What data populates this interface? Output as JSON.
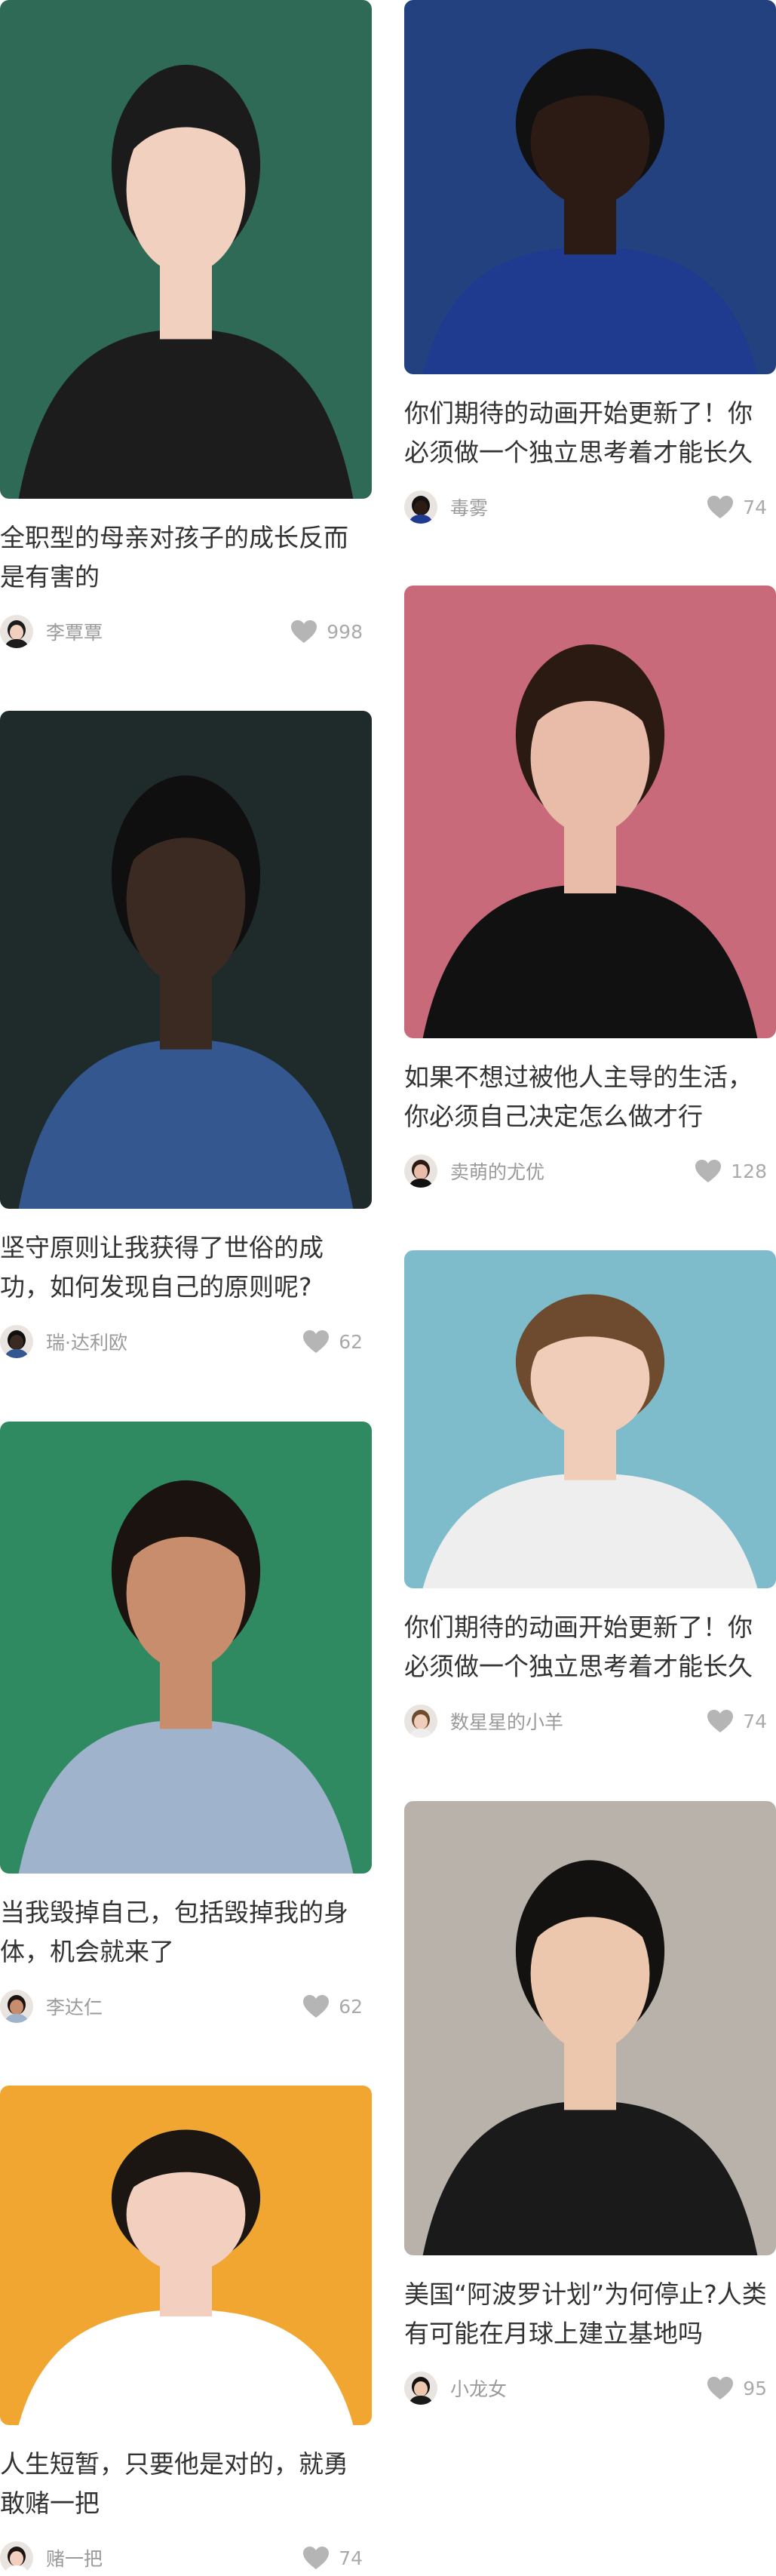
{
  "cards": [
    {
      "id": "c1",
      "title": "全职型的母亲对孩子的成长反而是有害的",
      "author": "李覃覃",
      "likes": "998",
      "bg": "#2e6a55",
      "skin": "#f1d0bf",
      "hair": "#1b1b1b",
      "shirt": "#1c1c1c"
    },
    {
      "id": "c2",
      "title": "你们期待的动画开始更新了！你必须做一个独立思考着才能长久",
      "author": "毒雾",
      "likes": "74",
      "bg": "#23407f",
      "skin": "#2b1b14",
      "hair": "#111111",
      "shirt": "#1f3b8f"
    },
    {
      "id": "c3",
      "title": "坚守原则让我获得了世俗的成功，如何发现自己的原则呢?",
      "author": "瑞·达利欧",
      "likes": "62",
      "bg": "#1f2a2a",
      "skin": "#3b2a22",
      "hair": "#0f0f0f",
      "shirt": "#33578e"
    },
    {
      "id": "c4",
      "title": "如果不想过被他人主导的生活，你必须自己决定怎么做才行",
      "author": "卖萌的尤优",
      "likes": "128",
      "bg": "#c86a7a",
      "skin": "#e8bca8",
      "hair": "#2a1a12",
      "shirt": "#111111"
    },
    {
      "id": "c5",
      "title": "当我毁掉自己，包括毁掉我的身体，机会就来了",
      "author": "李达仁",
      "likes": "62",
      "bg": "#2f8a62",
      "skin": "#c88d6c",
      "hair": "#1a1310",
      "shirt": "#9fb3cc"
    },
    {
      "id": "c6",
      "title": "你们期待的动画开始更新了！你必须做一个独立思考着才能长久",
      "author": "数星星的小羊",
      "likes": "74",
      "bg": "#7fbccb",
      "skin": "#f0cdb9",
      "hair": "#6e4a2f",
      "shirt": "#eeeeee"
    },
    {
      "id": "c7",
      "title": "人生短暂，只要他是对的，就勇敢赌一把",
      "author": "赌一把",
      "likes": "74",
      "bg": "#f0a630",
      "skin": "#f2cfbf",
      "hair": "#1b1612",
      "shirt": "#ffffff"
    },
    {
      "id": "c8",
      "title": "美国“阿波罗计划”为何停止?人类有可能在月球上建立基地吗",
      "author": "小龙女",
      "likes": "95",
      "bg": "#b8b2ab",
      "skin": "#ecc7ae",
      "hair": "#141210",
      "shirt": "#1a1a1a"
    }
  ],
  "colors": {
    "text": "#333333",
    "meta": "#9a9a9a",
    "heart": "#b5b5b5"
  },
  "icons": {
    "like": "heart-icon"
  }
}
